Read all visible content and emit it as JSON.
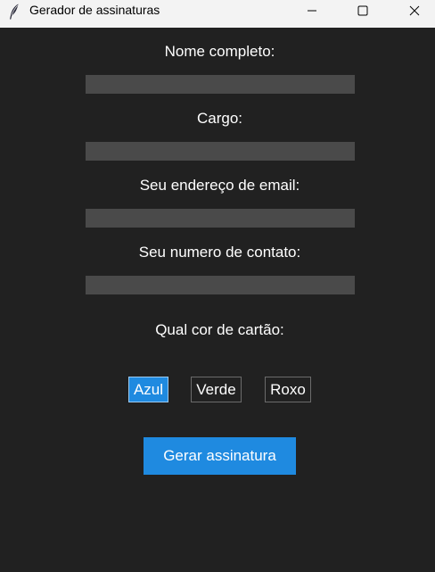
{
  "window": {
    "title": "Gerador de assinaturas",
    "icon": "feather-icon",
    "controls": [
      "minimize-icon",
      "maximize-icon",
      "close-icon"
    ]
  },
  "form": {
    "fields": [
      {
        "label": "Nome completo:",
        "value": ""
      },
      {
        "label": "Cargo:",
        "value": ""
      },
      {
        "label": "Seu endereço de email:",
        "value": ""
      },
      {
        "label": "Seu numero de contato:",
        "value": ""
      }
    ],
    "color_question": "Qual cor de cartão:",
    "color_options": [
      {
        "label": "Azul",
        "selected": true
      },
      {
        "label": "Verde",
        "selected": false
      },
      {
        "label": "Roxo",
        "selected": false
      }
    ],
    "submit_label": "Gerar assinatura"
  },
  "colors": {
    "background": "#212121",
    "entry_bg": "#4a4a4a",
    "accent": "#1f8ae0",
    "titlebar": "#f3f3f3"
  }
}
